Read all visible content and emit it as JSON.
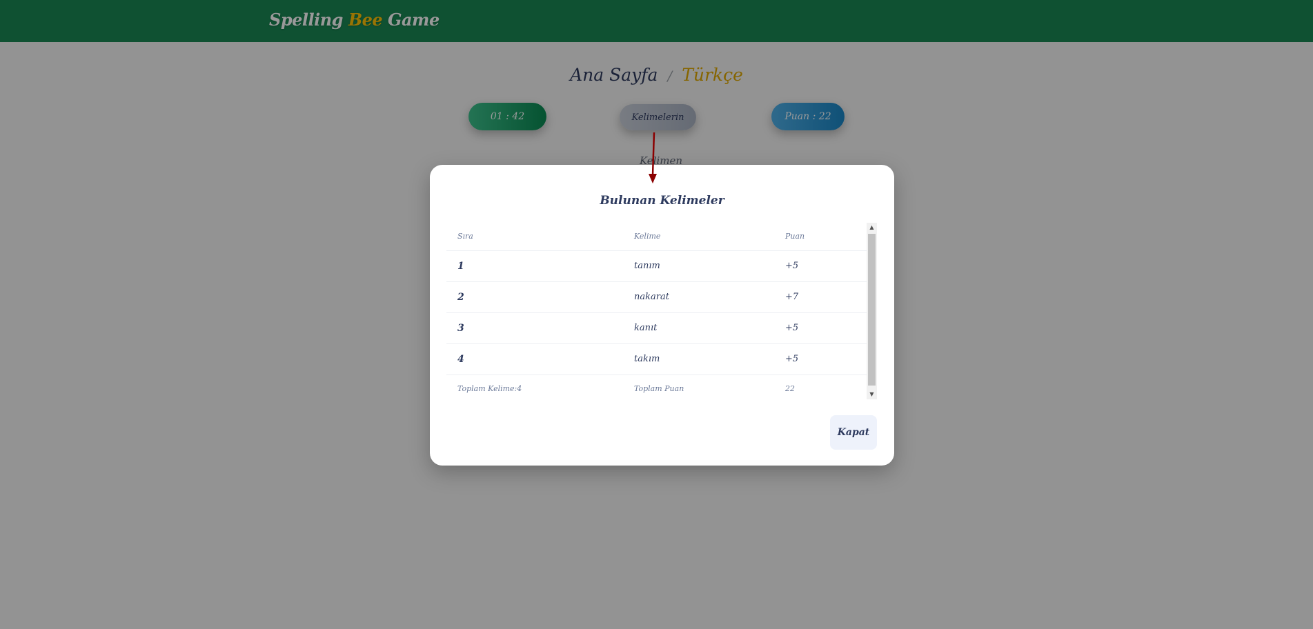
{
  "navbar": {
    "brand_part1": "Spelling ",
    "brand_part2": "Bee",
    "brand_part3": " Game"
  },
  "breadcrumb": {
    "home": "Ana Sayfa",
    "separator": "/",
    "language": "Türkçe"
  },
  "stats": {
    "timer": "01 : 42",
    "words_button": "Kelimelerin",
    "score": "Puan : 22"
  },
  "background_label": "Kelimen",
  "modal": {
    "title": "Bulunan Kelimeler",
    "headers": [
      "Sıra",
      "Kelime",
      "Puan"
    ],
    "rows": [
      {
        "order": "1",
        "word": "tanım",
        "points": "+5"
      },
      {
        "order": "2",
        "word": "nakarat",
        "points": "+7"
      },
      {
        "order": "3",
        "word": "kanıt",
        "points": "+5"
      },
      {
        "order": "4",
        "word": "takım",
        "points": "+5"
      }
    ],
    "footer": {
      "total_words": "Toplam Kelime:4",
      "total_points_label": "Toplam Puan",
      "total_points": "22"
    },
    "close_label": "Kapat"
  },
  "colors": {
    "navbar": "#198754",
    "accent_yellow": "#ffc107",
    "text_dark": "#2d3a5e",
    "annotation_arrow": "#8b0000"
  }
}
